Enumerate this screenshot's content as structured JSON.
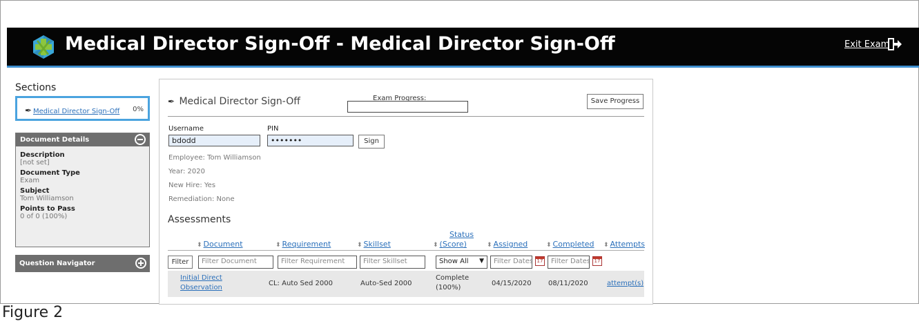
{
  "header": {
    "title": "Medical Director Sign-Off - Medical Director Sign-Off",
    "exit_label": "Exit Exam",
    "logo_icon": "hexagon-cross-logo-icon",
    "accent_color": "#3e8fd0"
  },
  "sidebar": {
    "sections_title": "Sections",
    "section_item": {
      "label": "Medical Director Sign-Off",
      "percent": "0%"
    },
    "document_details": {
      "title": "Document Details",
      "fields": [
        {
          "label": "Description",
          "value": "[not set]"
        },
        {
          "label": "Document Type",
          "value": "Exam"
        },
        {
          "label": "Subject",
          "value": "Tom Williamson"
        },
        {
          "label": "Points to Pass",
          "value": "0 of 0 (100%)"
        }
      ]
    },
    "question_navigator": "Question Navigator"
  },
  "main": {
    "title": "Medical Director Sign-Off",
    "progress_label": "Exam Progress:",
    "save_label": "Save Progress",
    "username_label": "Username",
    "username_value": "bdodd",
    "pin_label": "PIN",
    "pin_value": "•••••••",
    "sign_label": "Sign",
    "info": {
      "employee": "Employee: Tom Williamson",
      "year": "Year: 2020",
      "new_hire": "New Hire: Yes",
      "remediation": "Remediation: None"
    },
    "assessments_title": "Assessments",
    "columns": {
      "document": "Document",
      "requirement": "Requirement",
      "skillset": "Skillset",
      "status_top": "Status",
      "status_bottom": "(Score)",
      "assigned": "Assigned",
      "completed": "Completed",
      "attempts": "Attempts"
    },
    "filters": {
      "button": "Filter",
      "document": "Filter Document",
      "requirement": "Filter Requirement",
      "skillset": "Filter Skillset",
      "status": "Show All",
      "assigned": "Filter Dates",
      "completed": "Filter Dates",
      "cal_day": "17"
    },
    "rows": [
      {
        "document_line1": "Initial Direct",
        "document_line2": "Observation",
        "requirement": "CL: Auto Sed 2000",
        "skillset": "Auto-Sed 2000",
        "status_line1": "Complete",
        "status_line2": "(100%)",
        "assigned": "04/15/2020",
        "completed": "08/11/2020",
        "attempts": "attempt(s)"
      }
    ]
  },
  "caption": "Figure 2"
}
